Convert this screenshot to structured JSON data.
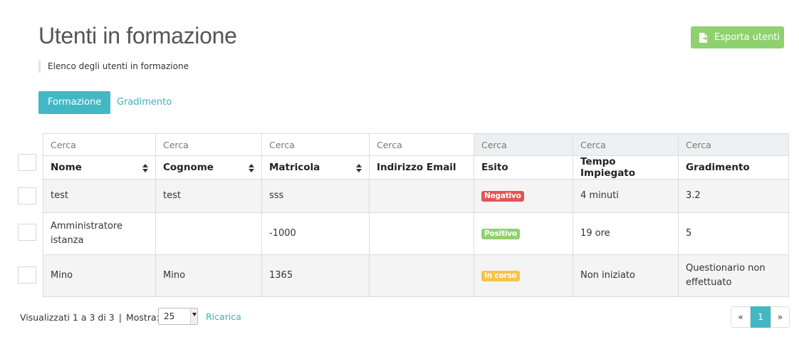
{
  "header": {
    "title": "Utenti in formazione",
    "subtitle": "Elenco degli utenti in formazione",
    "export_label": "Esporta utenti",
    "export_icon": "file-export-icon"
  },
  "tabs": [
    {
      "label": "Formazione",
      "active": true
    },
    {
      "label": "Gradimento",
      "active": false
    }
  ],
  "table": {
    "search_placeholder": "Cerca",
    "columns": [
      "Nome",
      "Cognome",
      "Matricola",
      "Indirizzo Email",
      "Esito",
      "Tempo Impiegato",
      "Gradimento"
    ],
    "rows": [
      {
        "nome": "test",
        "cognome": "test",
        "matricola": "sss",
        "email": "",
        "esito": "Negativo",
        "tempo": "4 minuti",
        "gradimento": "3.2"
      },
      {
        "nome": "Amministratore istanza",
        "cognome": "",
        "matricola": "-1000",
        "email": "",
        "esito": "Positivo",
        "tempo": "19 ore",
        "gradimento": "5"
      },
      {
        "nome": "Mino",
        "cognome": "Mino",
        "matricola": "1365",
        "email": "",
        "esito": "In corso",
        "tempo": "Non iniziato",
        "gradimento": "Questionario non effettuato"
      }
    ]
  },
  "footer": {
    "info": "Visualizzati 1 a 3 di 3",
    "separator": "|",
    "show_label": "Mostra:",
    "page_size": "25",
    "reload_label": "Ricarica",
    "pager": {
      "prev": "«",
      "current": "1",
      "next": "»"
    }
  },
  "colors": {
    "accent": "#42b8c4",
    "export": "#8fd16f",
    "negativo": "#e05555",
    "positivo": "#8fd16f",
    "in_corso": "#f6c34a"
  }
}
